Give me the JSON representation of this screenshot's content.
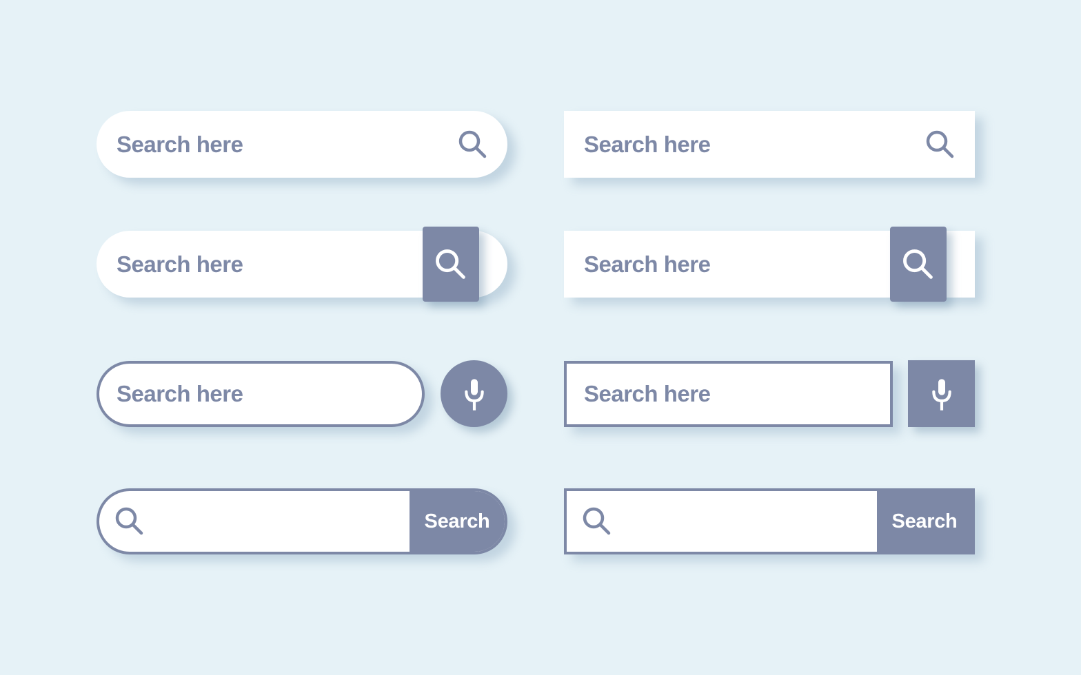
{
  "colors": {
    "background": "#e6f2f7",
    "accent": "#7d88a6",
    "field": "#ffffff"
  },
  "search_bars": [
    {
      "variant": "pill-with-icon",
      "placeholder": "Search here",
      "icon": "search-icon"
    },
    {
      "variant": "pill-with-square-button",
      "placeholder": "Search here",
      "icon": "search-icon"
    },
    {
      "variant": "outlined-pill-with-mic",
      "placeholder": "Search here",
      "icon": "microphone-icon"
    },
    {
      "variant": "outlined-pill-with-search-button",
      "placeholder": "",
      "icon": "search-icon",
      "button_label": "Search"
    },
    {
      "variant": "rect-with-icon",
      "placeholder": "Search here",
      "icon": "search-icon"
    },
    {
      "variant": "rect-with-square-button",
      "placeholder": "Search here",
      "icon": "search-icon"
    },
    {
      "variant": "outlined-rect-with-mic",
      "placeholder": "Search here",
      "icon": "microphone-icon"
    },
    {
      "variant": "outlined-rect-with-search-button",
      "placeholder": "",
      "icon": "search-icon",
      "button_label": "Search"
    }
  ]
}
